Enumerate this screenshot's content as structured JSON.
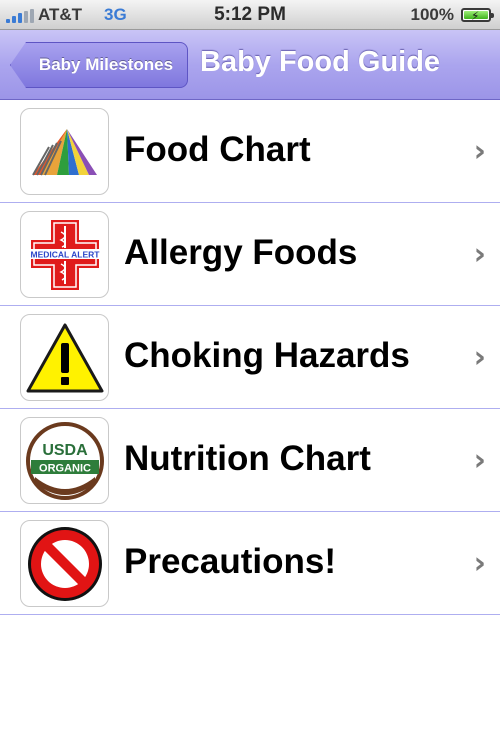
{
  "status": {
    "carrier": "AT&T",
    "network": "3G",
    "time": "5:12 PM",
    "battery": "100%",
    "battery_level": 1.0,
    "signal_bars": 4
  },
  "nav": {
    "back_label": "Baby Milestones",
    "title": "Baby Food Guide",
    "bar_color": "#aba5ee"
  },
  "items": [
    {
      "label": "Food Chart",
      "icon": "food-pyramid-icon"
    },
    {
      "label": "Allergy Foods",
      "icon": "medical-alert-icon",
      "icon_text": "MEDICAL ALERT"
    },
    {
      "label": "Choking Hazards",
      "icon": "warning-triangle-icon",
      "icon_text": "!"
    },
    {
      "label": "Nutrition Chart",
      "icon": "usda-organic-icon",
      "icon_text_top": "USDA",
      "icon_text_bottom": "ORGANIC"
    },
    {
      "label": "Precautions!",
      "icon": "prohibited-sign-icon"
    }
  ],
  "chevron": "›"
}
